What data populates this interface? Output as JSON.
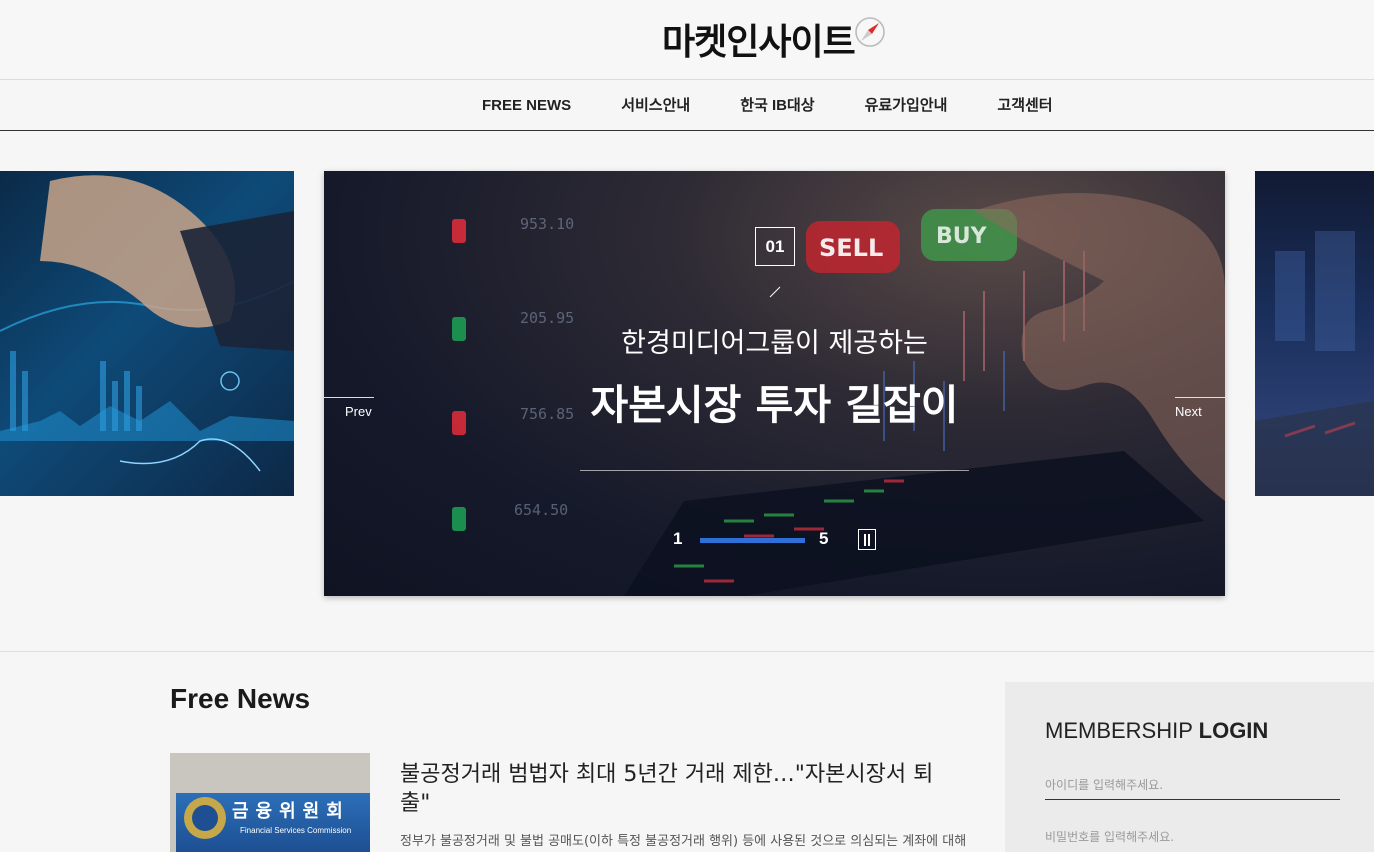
{
  "header": {
    "logo_text": "마켓인사이트",
    "logo_icon": "compass-icon"
  },
  "nav": {
    "items": [
      {
        "label": "FREE NEWS"
      },
      {
        "label": "서비스안내"
      },
      {
        "label": "한국 IB대상"
      },
      {
        "label": "유료가입안내"
      },
      {
        "label": "고객센터"
      }
    ]
  },
  "slider": {
    "slide_number": "01",
    "subtitle": "한경미디어그룹이 제공하는",
    "title": "자본시장 투자 길잡이",
    "prev_label": "Prev",
    "next_label": "Next",
    "current_page": "1",
    "total_pages": "5",
    "progress": 1.0,
    "accent_color": "#2f6fd8",
    "background_labels": [
      "SELL",
      "BUY"
    ],
    "price_labels": [
      "953.10",
      "205.95",
      "756.85",
      "654.50"
    ]
  },
  "news": {
    "section_title": "Free News",
    "article": {
      "headline": "불공정거래 범법자 최대 5년간 거래 제한…\"자본시장서 퇴출\"",
      "summary": "정부가 불공정거래 및 불법 공매도(이하 특정 불공정거래 행위) 등에 사용된 것으로 의심되는 계좌에 대해",
      "thumb_sign_ko": "금융위원회",
      "thumb_sign_en": "Financial Services Commission"
    }
  },
  "login": {
    "title_light": "MEMBERSHIP",
    "title_bold": "LOGIN",
    "id_placeholder": "아이디를 입력해주세요.",
    "pw_placeholder": "비밀번호를 입력해주세요."
  }
}
